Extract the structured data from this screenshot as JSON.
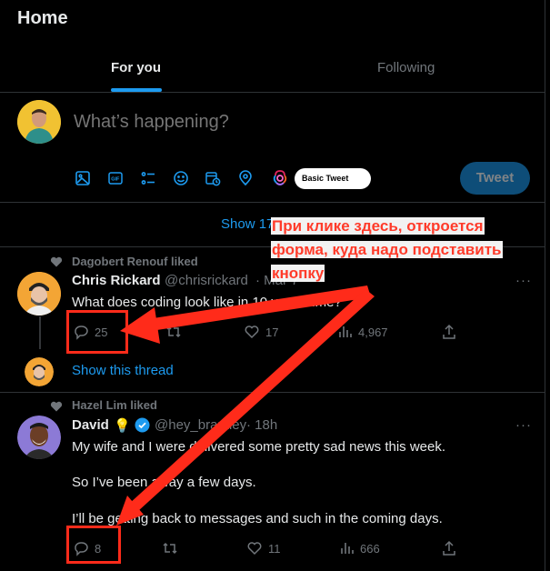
{
  "header": {
    "title": "Home"
  },
  "tabs": [
    {
      "label": "For you",
      "active": true
    },
    {
      "label": "Following",
      "active": false
    }
  ],
  "composer": {
    "placeholder": "What’s happening?",
    "basic_tweet_label": "Basic Tweet",
    "tweet_button_label": "Tweet",
    "toolbar_icons": [
      "image-icon",
      "gif-icon",
      "poll-icon",
      "emoji-icon",
      "schedule-icon",
      "location-icon",
      "ai-icon"
    ]
  },
  "show_more": {
    "label": "Show 17"
  },
  "tweets": [
    {
      "liked_by": "Dagobert Renouf liked",
      "name": "Chris Rickard",
      "handle": "@chrisrickard",
      "date": "· Mar 7",
      "text": "What does coding look like in 10 years time?",
      "replies": "25",
      "retweets": "",
      "likes": "17",
      "views": "4,967",
      "show_thread": "Show this thread"
    },
    {
      "liked_by": "Hazel Lim liked",
      "name": "David",
      "emoji": "💡",
      "handle": "@hey_brantley",
      "date": "· 18h",
      "lines": [
        "My wife and I were delivered some pretty sad news this week.",
        "So I’ve been away a few days.",
        "I’ll be getting back to messages and such in the coming days."
      ],
      "replies": "8",
      "retweets": "",
      "likes": "11",
      "views": "666"
    }
  ],
  "annotation": {
    "lines": [
      "При клике здесь, откроется",
      "форма, куда надо подставить",
      "кнопку"
    ]
  },
  "colors": {
    "accent": "#1d9bf0",
    "annotation_red": "#ff2b1a",
    "background": "#000000",
    "border": "#2f3336"
  }
}
